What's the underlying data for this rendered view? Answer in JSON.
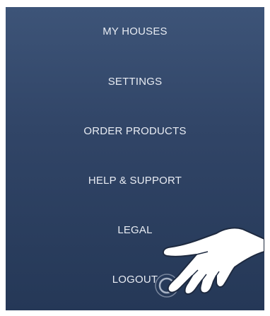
{
  "menu": {
    "items": [
      {
        "label": "MY HOUSES"
      },
      {
        "label": "SETTINGS"
      },
      {
        "label": "ORDER PRODUCTS"
      },
      {
        "label": "HELP & SUPPORT"
      },
      {
        "label": "LEGAL"
      },
      {
        "label": "LOGOUT"
      }
    ]
  },
  "colors": {
    "background_top": "#3d5478",
    "background_bottom": "#253857",
    "text": "#e8ecf3"
  },
  "overlay": {
    "icon": "pointing-hand-icon"
  }
}
